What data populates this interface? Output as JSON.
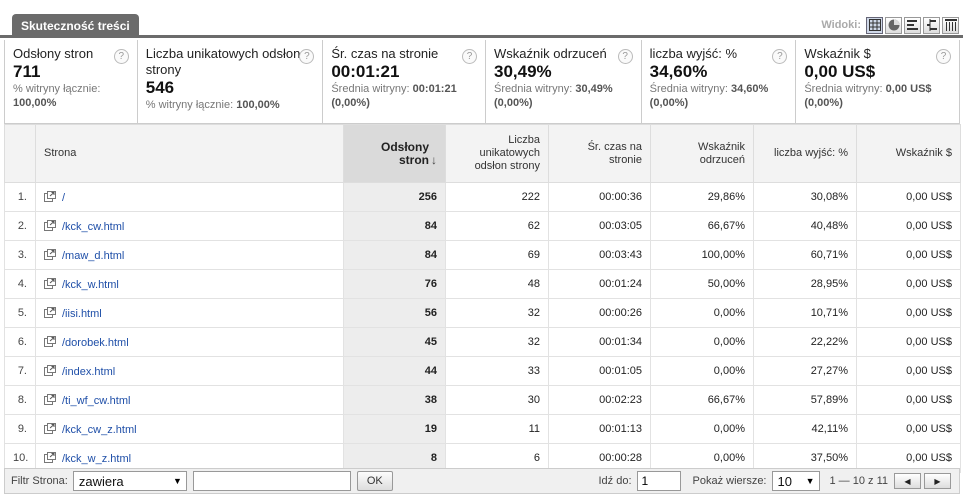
{
  "tab": {
    "title": "Skuteczność treści"
  },
  "views": {
    "label": "Widoki:",
    "items": [
      "table-view-icon",
      "pie-view-icon",
      "performance-view-icon",
      "comparison-view-icon",
      "pivot-view-icon"
    ]
  },
  "metrics": [
    {
      "title": "Odsłony stron",
      "value": "711",
      "sub": "% witryny łącznie:",
      "sub_value": "100,00%"
    },
    {
      "title": "Liczba unikatowych odsłon strony",
      "value": "546",
      "sub": "% witryny łącznie:",
      "sub_value": "100,00%"
    },
    {
      "title": "Śr. czas na stronie",
      "value": "00:01:21",
      "sub": "Średnia witryny:",
      "sub_value": "00:01:21",
      "sub_extra": "(0,00%)"
    },
    {
      "title": "Wskaźnik odrzuceń",
      "value": "30,49%",
      "sub": "Średnia witryny:",
      "sub_value": "30,49%",
      "sub_extra": "(0,00%)"
    },
    {
      "title": "liczba wyjść: %",
      "value": "34,60%",
      "sub": "Średnia witryny:",
      "sub_value": "34,60%",
      "sub_extra": "(0,00%)"
    },
    {
      "title": "Wskaźnik $",
      "value": "0,00 US$",
      "sub": "Średnia witryny:",
      "sub_value": "0,00 US$",
      "sub_extra": "(0,00%)"
    }
  ],
  "help_symbol": "?",
  "table": {
    "headers": {
      "page": "Strona",
      "pageviews": "Odsłony stron",
      "unique": "Liczba unikatowych odsłon strony",
      "avg_time": "Śr. czas na stronie",
      "bounce": "Wskaźnik odrzuceń",
      "exit": "liczba wyjść: %",
      "value": "Wskaźnik $"
    },
    "sort_arrow": "↓",
    "rows": [
      {
        "idx": "1.",
        "page": "/",
        "pageviews": "256",
        "unique": "222",
        "avg_time": "00:00:36",
        "bounce": "29,86%",
        "exit": "30,08%",
        "value": "0,00 US$"
      },
      {
        "idx": "2.",
        "page": "/kck_cw.html",
        "pageviews": "84",
        "unique": "62",
        "avg_time": "00:03:05",
        "bounce": "66,67%",
        "exit": "40,48%",
        "value": "0,00 US$"
      },
      {
        "idx": "3.",
        "page": "/maw_d.html",
        "pageviews": "84",
        "unique": "69",
        "avg_time": "00:03:43",
        "bounce": "100,00%",
        "exit": "60,71%",
        "value": "0,00 US$"
      },
      {
        "idx": "4.",
        "page": "/kck_w.html",
        "pageviews": "76",
        "unique": "48",
        "avg_time": "00:01:24",
        "bounce": "50,00%",
        "exit": "28,95%",
        "value": "0,00 US$"
      },
      {
        "idx": "5.",
        "page": "/iisi.html",
        "pageviews": "56",
        "unique": "32",
        "avg_time": "00:00:26",
        "bounce": "0,00%",
        "exit": "10,71%",
        "value": "0,00 US$"
      },
      {
        "idx": "6.",
        "page": "/dorobek.html",
        "pageviews": "45",
        "unique": "32",
        "avg_time": "00:01:34",
        "bounce": "0,00%",
        "exit": "22,22%",
        "value": "0,00 US$"
      },
      {
        "idx": "7.",
        "page": "/index.html",
        "pageviews": "44",
        "unique": "33",
        "avg_time": "00:01:05",
        "bounce": "0,00%",
        "exit": "27,27%",
        "value": "0,00 US$"
      },
      {
        "idx": "8.",
        "page": "/ti_wf_cw.html",
        "pageviews": "38",
        "unique": "30",
        "avg_time": "00:02:23",
        "bounce": "66,67%",
        "exit": "57,89%",
        "value": "0,00 US$"
      },
      {
        "idx": "9.",
        "page": "/kck_cw_z.html",
        "pageviews": "19",
        "unique": "11",
        "avg_time": "00:01:13",
        "bounce": "0,00%",
        "exit": "42,11%",
        "value": "0,00 US$"
      },
      {
        "idx": "10.",
        "page": "/kck_w_z.html",
        "pageviews": "8",
        "unique": "6",
        "avg_time": "00:00:28",
        "bounce": "0,00%",
        "exit": "37,50%",
        "value": "0,00 US$"
      }
    ]
  },
  "footer": {
    "filter_label": "Filtr Strona:",
    "filter_mode": "zawiera",
    "filter_value": "",
    "ok_label": "OK",
    "goto_label": "Idź do:",
    "goto_value": "1",
    "rows_label": "Pokaż wiersze:",
    "rows_value": "10",
    "range": "1 — 10 z 11",
    "prev_symbol": "◀",
    "next_symbol": "▶"
  }
}
